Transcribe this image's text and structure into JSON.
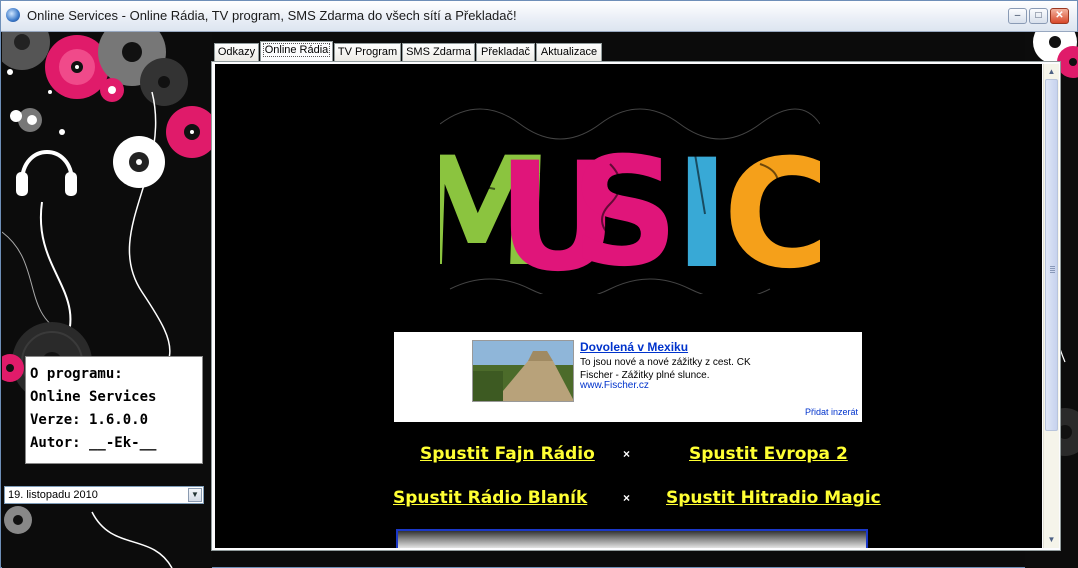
{
  "window": {
    "title": "Online Services - Online Rádia, TV program, SMS Zdarma do všech sítí a Překladač!",
    "minimize_glyph": "–",
    "maximize_glyph": "□",
    "close_glyph": "✕"
  },
  "tabs": [
    {
      "label": "Odkazy",
      "active": false
    },
    {
      "label": "Online Rádia",
      "active": true
    },
    {
      "label": "TV Program",
      "active": false
    },
    {
      "label": "SMS Zdarma",
      "active": false
    },
    {
      "label": "Překladač",
      "active": false
    },
    {
      "label": "Aktualizace",
      "active": false
    }
  ],
  "info": {
    "line1": "O programu:",
    "line2": "Online Services",
    "line3": "Verze: 1.6.0.0",
    "line4": "Autor: __-Ek-__"
  },
  "date_select": {
    "value": "19. listopadu 2010"
  },
  "ad": {
    "title": "Dovolená v Mexiku",
    "text": "To jsou nové a nové zážitky z cest. CK Fischer - Zážitky plné slunce.",
    "url": "www.Fischer.cz",
    "post_label": "Přidat inzerát"
  },
  "links": {
    "fajn": "Spustit Fajn Rádio",
    "evropa": "Spustit Evropa 2",
    "blanik": "Spustit Rádio Blaník",
    "hitradio": "Spustit Hitradio Magic",
    "separator": "×"
  },
  "colors": {
    "link_yellow": "#ffff33",
    "music_green": "#8bc43f",
    "music_pink": "#e0157a",
    "music_blue": "#38a9d6",
    "music_orange": "#f5a01a"
  }
}
